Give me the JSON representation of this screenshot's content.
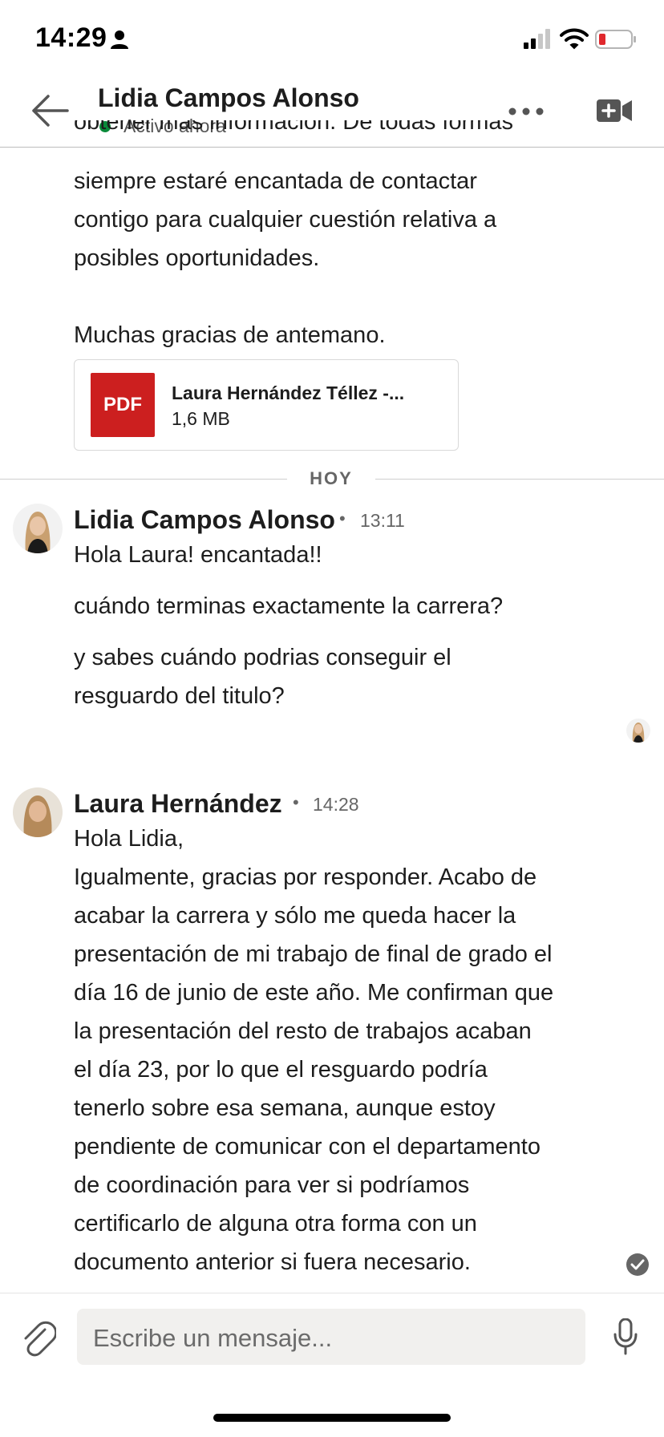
{
  "status_bar": {
    "time": "14:29"
  },
  "header": {
    "contact_name": "Lidia Campos Alonso",
    "presence": "Activo ahora",
    "presence_color": "#0a8a3a"
  },
  "earlier_message": {
    "clipped_line": "obtener más información. De todas formas",
    "text": "siempre estaré encantada de contactar\ncontigo para cualquier cuestión relativa a\nposibles oportunidades.\n\nMuchas gracias de antemano.",
    "attachment": {
      "type_badge": "PDF",
      "name": "Laura Hernández Téllez -...",
      "size": "1,6 MB",
      "badge_color": "#cc1f1f"
    }
  },
  "day_separator": "HOY",
  "messages": [
    {
      "sender": "Lidia Campos Alonso",
      "time": "13:11",
      "lines": [
        "Hola Laura! encantada!!",
        "cuándo terminas exactamente la carrera?",
        "y sabes cuándo podrias conseguir el\nresguardo del titulo?"
      ]
    },
    {
      "sender": "Laura Hernández",
      "time": "14:28",
      "text": "Hola Lidia,\nIgualmente, gracias por responder. Acabo de\nacabar la carrera y sólo me queda hacer la\npresentación de mi trabajo de final de grado el\ndía 16 de junio de este año. Me confirman que\nla presentación del resto de trabajos acaban\nel día 23, por lo que el resguardo podría\ntenerlo sobre esa semana, aunque estoy\npendiente de comunicar con el departamento\nde coordinación para ver si podríamos\ncertificarlo de alguna otra forma con un\ndocumento anterior si fuera necesario."
    }
  ],
  "composer": {
    "placeholder": "Escribe un mensaje..."
  },
  "icons": {
    "back": "arrow-left-icon",
    "more": "more-horizontal-icon",
    "video": "video-plus-icon",
    "attach": "paperclip-icon",
    "mic": "microphone-icon"
  }
}
